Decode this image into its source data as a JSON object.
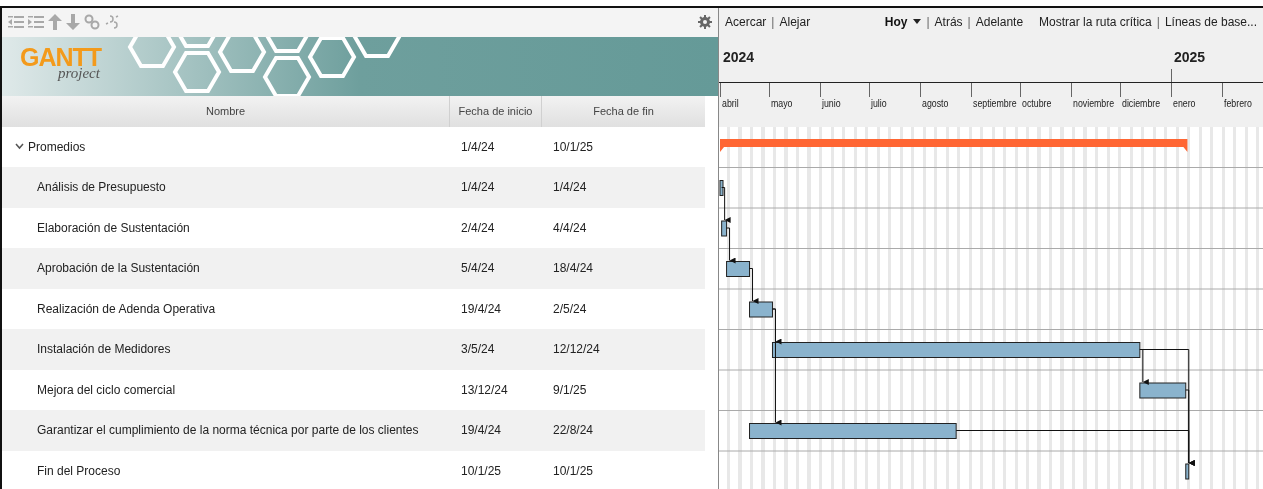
{
  "logo": {
    "title": "GANTT",
    "subtitle": "project"
  },
  "columns": [
    "Nombre",
    "Fecha de inicio",
    "Fecha de fin"
  ],
  "tasks": [
    {
      "kind": "summary",
      "name": "Promedios",
      "start": "1/4/24",
      "end": "10/1/25",
      "expanded": true
    },
    {
      "kind": "task",
      "name": "Análisis de Presupuesto",
      "start": "1/4/24",
      "end": "1/4/24"
    },
    {
      "kind": "task",
      "name": "Elaboración de Sustentación",
      "start": "2/4/24",
      "end": "4/4/24"
    },
    {
      "kind": "task",
      "name": "Aprobación de la Sustentación",
      "start": "5/4/24",
      "end": "18/4/24"
    },
    {
      "kind": "task",
      "name": "Realización de Adenda Operativa",
      "start": "19/4/24",
      "end": "2/5/24"
    },
    {
      "kind": "task",
      "name": "Instalación de Medidores",
      "start": "3/5/24",
      "end": "12/12/24"
    },
    {
      "kind": "task",
      "name": "Mejora del ciclo comercial",
      "start": "13/12/24",
      "end": "9/1/25"
    },
    {
      "kind": "task",
      "name": "Garantizar el cumplimiento de la norma técnica por parte de los clientes",
      "start": "19/4/24",
      "end": "22/8/24"
    },
    {
      "kind": "task",
      "name": "Fin del Proceso",
      "start": "10/1/25",
      "end": "10/1/25"
    }
  ],
  "chart_toolbar": {
    "separator": "|",
    "zoom_links": [
      "Acercar",
      "Alejar"
    ],
    "today": "Hoy",
    "nav_links": [
      "Atrás",
      "Adelante"
    ],
    "view_links": [
      "Mostrar la ruta crítica",
      "Líneas de base..."
    ]
  },
  "timeline": {
    "years": [
      "2024",
      "2025"
    ],
    "months": [
      "abril",
      "mayo",
      "junio",
      "julio",
      "agosto",
      "septiembre",
      "octubre",
      "noviembre",
      "diciembre",
      "enero",
      "febrero"
    ]
  }
}
